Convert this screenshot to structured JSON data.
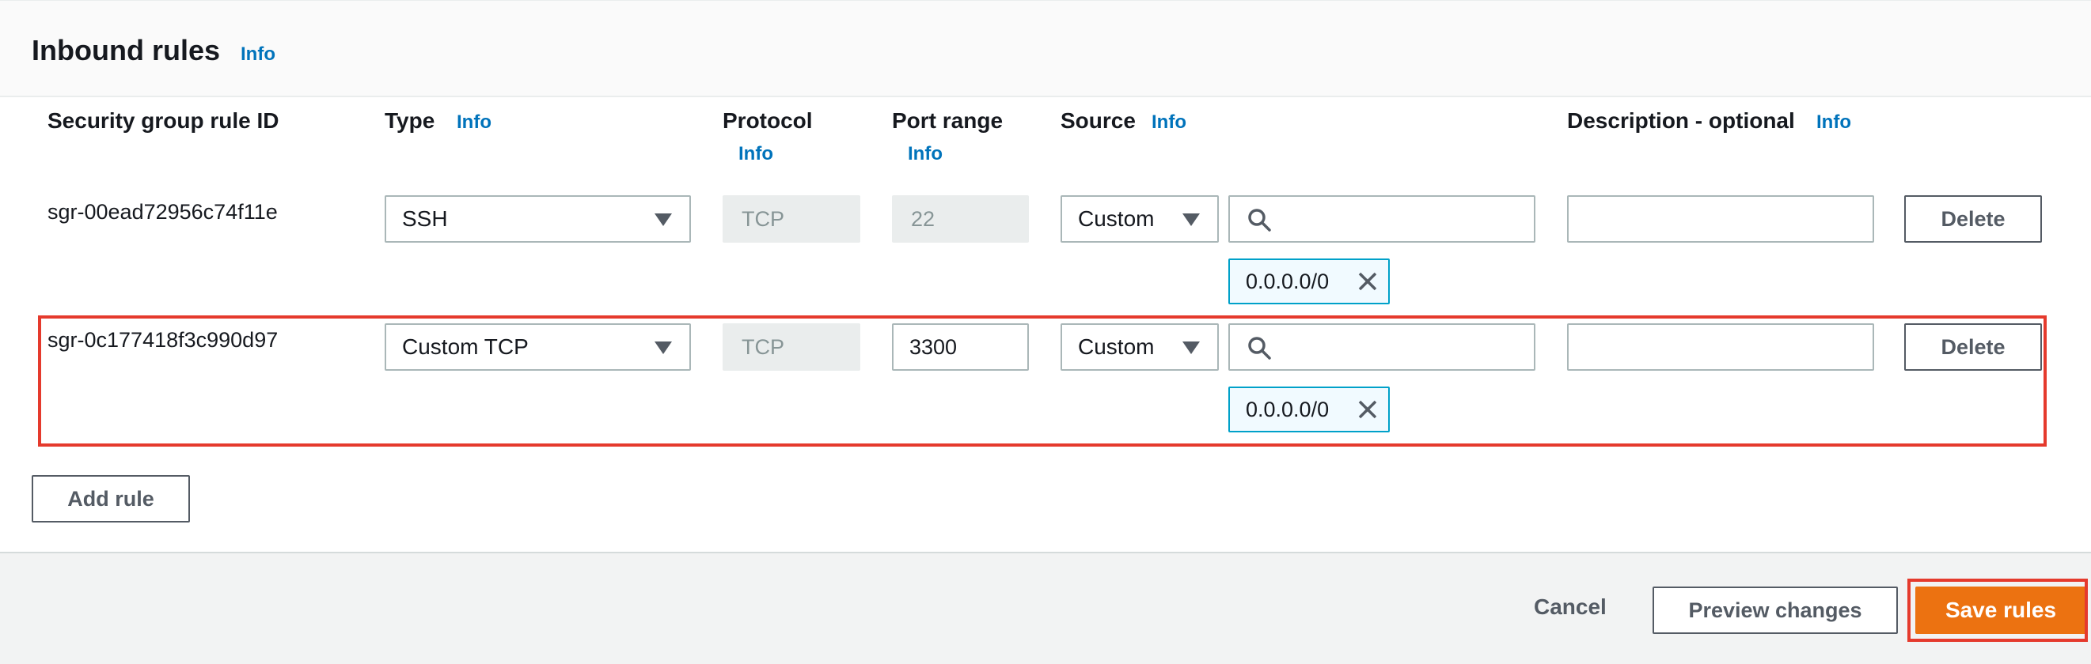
{
  "header": {
    "title": "Inbound rules",
    "info": "Info"
  },
  "columns": {
    "rule_id": "Security group rule ID",
    "type": "Type",
    "type_info": "Info",
    "protocol": "Protocol",
    "protocol_info": "Info",
    "port_range": "Port range",
    "port_info": "Info",
    "source": "Source",
    "source_info": "Info",
    "description": "Description - optional",
    "description_info": "Info"
  },
  "rules": [
    {
      "id": "sgr-00ead72956c74f11e",
      "type": "SSH",
      "protocol": "TCP",
      "port": "22",
      "source_type": "Custom",
      "source_search": "",
      "cidr": "0.0.0.0/0",
      "description": "",
      "delete_label": "Delete"
    },
    {
      "id": "sgr-0c177418f3c990d97",
      "type": "Custom TCP",
      "protocol": "TCP",
      "port": "3300",
      "source_type": "Custom",
      "source_search": "",
      "cidr": "0.0.0.0/0",
      "description": "",
      "delete_label": "Delete"
    }
  ],
  "add_rule_label": "Add rule",
  "footer": {
    "cancel": "Cancel",
    "preview": "Preview changes",
    "save": "Save rules"
  },
  "colors": {
    "accent": "#ec7211",
    "link": "#0073bb",
    "highlight": "#e53a2d"
  },
  "icons": {
    "search": "search-icon",
    "dropdown": "caret-down-icon",
    "remove": "close-icon"
  }
}
